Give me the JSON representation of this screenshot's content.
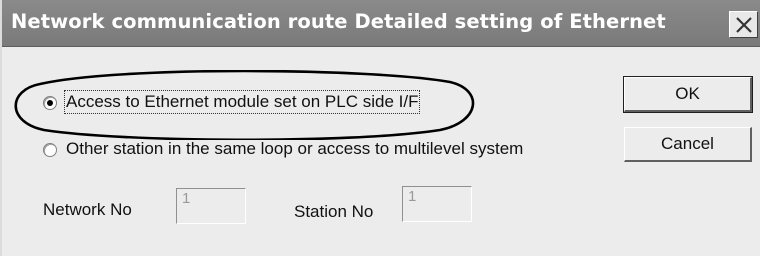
{
  "dialog": {
    "title": "Network communication route  Detailed setting of Ethernet",
    "close_icon": "close-icon"
  },
  "options": {
    "option1_label": "Access to Ethernet module set on PLC side I/F",
    "option1_selected": true,
    "option2_label": "Other station in the same loop or access to multilevel system",
    "option2_selected": false
  },
  "fields": {
    "network_label": "Network No",
    "network_value": "1",
    "station_label": "Station No",
    "station_value": "1"
  },
  "buttons": {
    "ok_label": "OK",
    "cancel_label": "Cancel"
  },
  "annotation": {
    "shape": "ellipse",
    "color": "#000000"
  },
  "colors": {
    "titlebar": "#808080",
    "dialog_bg": "#ececec"
  }
}
